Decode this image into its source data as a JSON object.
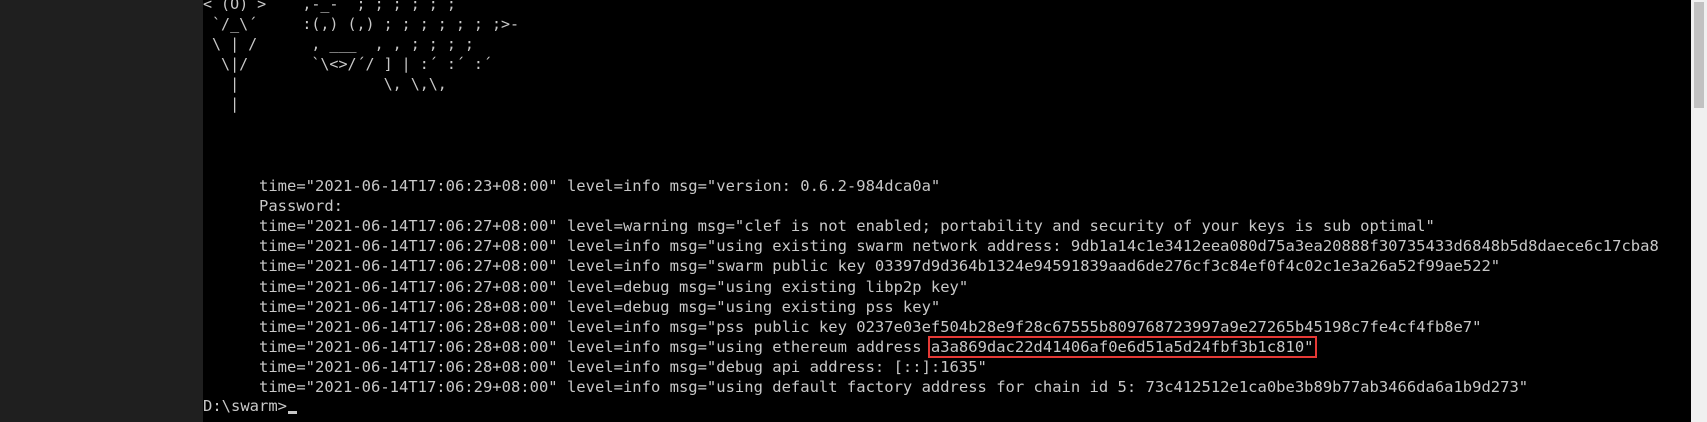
{
  "ascii_art": "< (O) >    ,-_-´ ; ; ; ; ; ;\n `/_\\´     :(,) (,) ; ; ; ; ; ; ;>-\n \\ | /      , ___  , , ; ; ; ;\n  \\|/       `\\<>/´/ ] | :´ :´ :´\n   |                \\, \\,\\,\n   |",
  "log_lines": [
    {
      "ts": "time=\"2021-06-14T17:06:23+08:00\"",
      "rest": " level=info msg=\"version: 0.6.2-984dca0a\""
    },
    {
      "plain": "Password:"
    },
    {
      "ts": "time=\"2021-06-14T17:06:27+08:00\"",
      "rest": " level=warning msg=\"clef is not enabled; portability and security of your keys is sub optimal\""
    },
    {
      "ts": "time=\"2021-06-14T17:06:27+08:00\"",
      "rest": " level=info msg=\"using existing swarm network address: 9db1a14c1e3412eea080d75a3ea20888f30735433d6848b5d8daece6c17cba8"
    },
    {
      "ts": "time=\"2021-06-14T17:06:27+08:00\"",
      "rest": " level=info msg=\"swarm public key 03397d9d364b1324e94591839aad6de276cf3c84ef0f4c02c1e3a26a52f99ae522\""
    },
    {
      "ts": "time=\"2021-06-14T17:06:27+08:00\"",
      "rest": " level=debug msg=\"using existing libp2p key\""
    },
    {
      "ts": "time=\"2021-06-14T17:06:28+08:00\"",
      "rest": " level=debug msg=\"using existing pss key\""
    },
    {
      "ts": "time=\"2021-06-14T17:06:28+08:00\"",
      "rest": " level=info msg=\"pss public key 0237e03ef504b28e9f28c67555b809768723997a9e27265b45198c7fe4cf4fb8e7\""
    },
    {
      "ts": "time=\"2021-06-14T17:06:28+08:00\"",
      "rest": " level=info msg=\"using ethereum address ",
      "highlight": "a3a869dac22d41406af0e6d51a5d24fbf3b1c810\""
    },
    {
      "ts": "time=\"2021-06-14T17:06:28+08:00\"",
      "rest": " level=info msg=\"debug api address: [::]:1635\""
    },
    {
      "ts": "time=\"2021-06-14T17:06:29+08:00\"",
      "rest": " level=info msg=\"using default factory address for chain id 5: 73c412512e1ca0be3b89b77ab3466da6a1b9d273\""
    }
  ],
  "prompt": "D:\\swarm>",
  "colors": {
    "text": "#c8c8c8",
    "background": "#000000",
    "highlight_border": "#e53935"
  }
}
